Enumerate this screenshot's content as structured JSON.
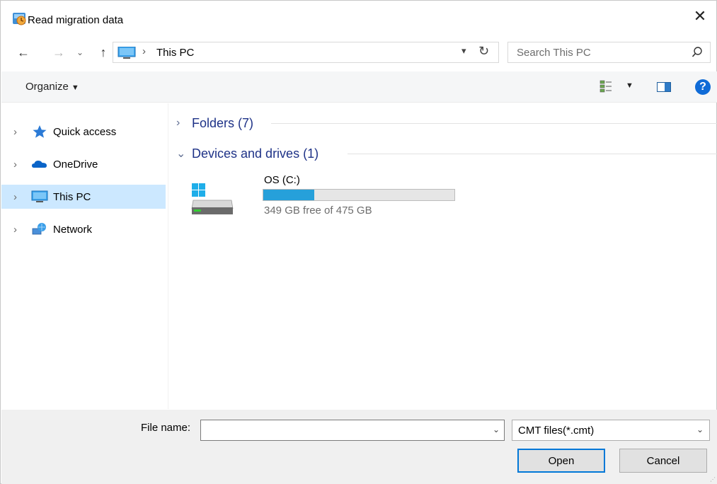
{
  "window": {
    "title": "Read migration data",
    "close_label": "✕"
  },
  "address": {
    "crumb_separator": "›",
    "crumb": "This PC"
  },
  "search": {
    "placeholder": "Search This PC"
  },
  "toolbar": {
    "organize_label": "Organize",
    "help_label": "?"
  },
  "nav": {
    "items": [
      {
        "label": "Quick access",
        "icon": "star-icon"
      },
      {
        "label": "OneDrive",
        "icon": "cloud-icon"
      },
      {
        "label": "This PC",
        "icon": "computer-icon",
        "selected": true
      },
      {
        "label": "Network",
        "icon": "network-icon"
      }
    ]
  },
  "content": {
    "groups": [
      {
        "label": "Folders (7)",
        "expanded": false
      },
      {
        "label": "Devices and drives (1)",
        "expanded": true
      }
    ],
    "drive": {
      "name": "OS (C:)",
      "free_text": "349 GB free of 475 GB",
      "used_fraction": 0.265
    }
  },
  "bottom": {
    "filename_label": "File name:",
    "filename_value": "",
    "filter_value": "CMT files(*.cmt)",
    "open_label": "Open",
    "cancel_label": "Cancel"
  },
  "colors": {
    "accent": "#0078d7",
    "selection": "#cce8ff",
    "drive_bar": "#26a0da",
    "group_header": "#1e3287"
  }
}
